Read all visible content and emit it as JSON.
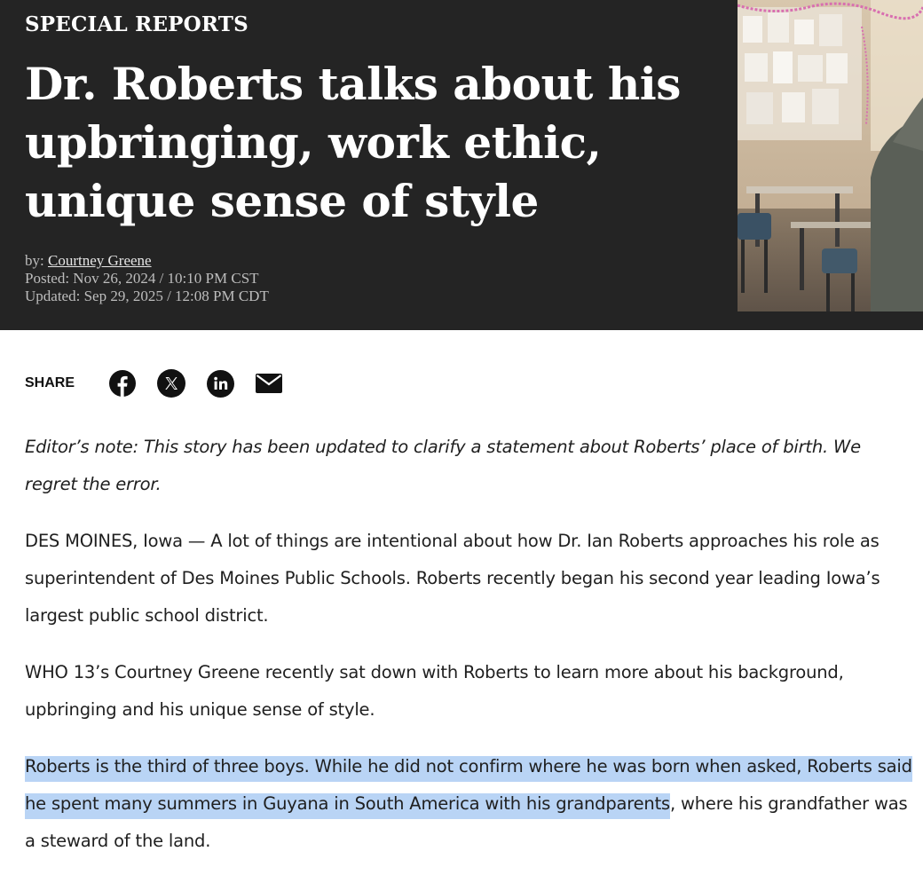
{
  "header": {
    "kicker": "SPECIAL REPORTS",
    "headline": "Dr. Roberts talks about his upbringing, work ethic, unique sense of style",
    "byline_prefix": "by: ",
    "author": "Courtney Greene",
    "posted": "Posted: Nov 26, 2024 / 10:10 PM CST",
    "updated": "Updated: Sep 29, 2025 / 12:08 PM CDT"
  },
  "share": {
    "label": "SHARE",
    "icons": [
      "facebook-icon",
      "x-icon",
      "linkedin-icon",
      "email-icon"
    ]
  },
  "article": {
    "editor_note": "Editor’s note: This story has been updated to clarify a statement about Roberts’ place of birth. We regret the error.",
    "p1": "DES MOINES, Iowa — A lot of things are intentional about how Dr. Ian Roberts approaches his role as superintendent of Des Moines Public Schools. Roberts recently began his second year leading Iowa’s largest public school district.",
    "p2": "WHO 13’s Courtney Greene recently sat down with Roberts to learn more about his background, upbringing and his unique sense of style.",
    "p3_highlighted": "Roberts is the third of three boys. While he did not confirm where he was born when asked, Roberts said he spent many summers in Guyana in South America with his grandparents",
    "p3_rest": ", where his grandfather was a steward of the land."
  },
  "colors": {
    "header_bg": "#242424",
    "highlight": "#b9d4f5"
  }
}
